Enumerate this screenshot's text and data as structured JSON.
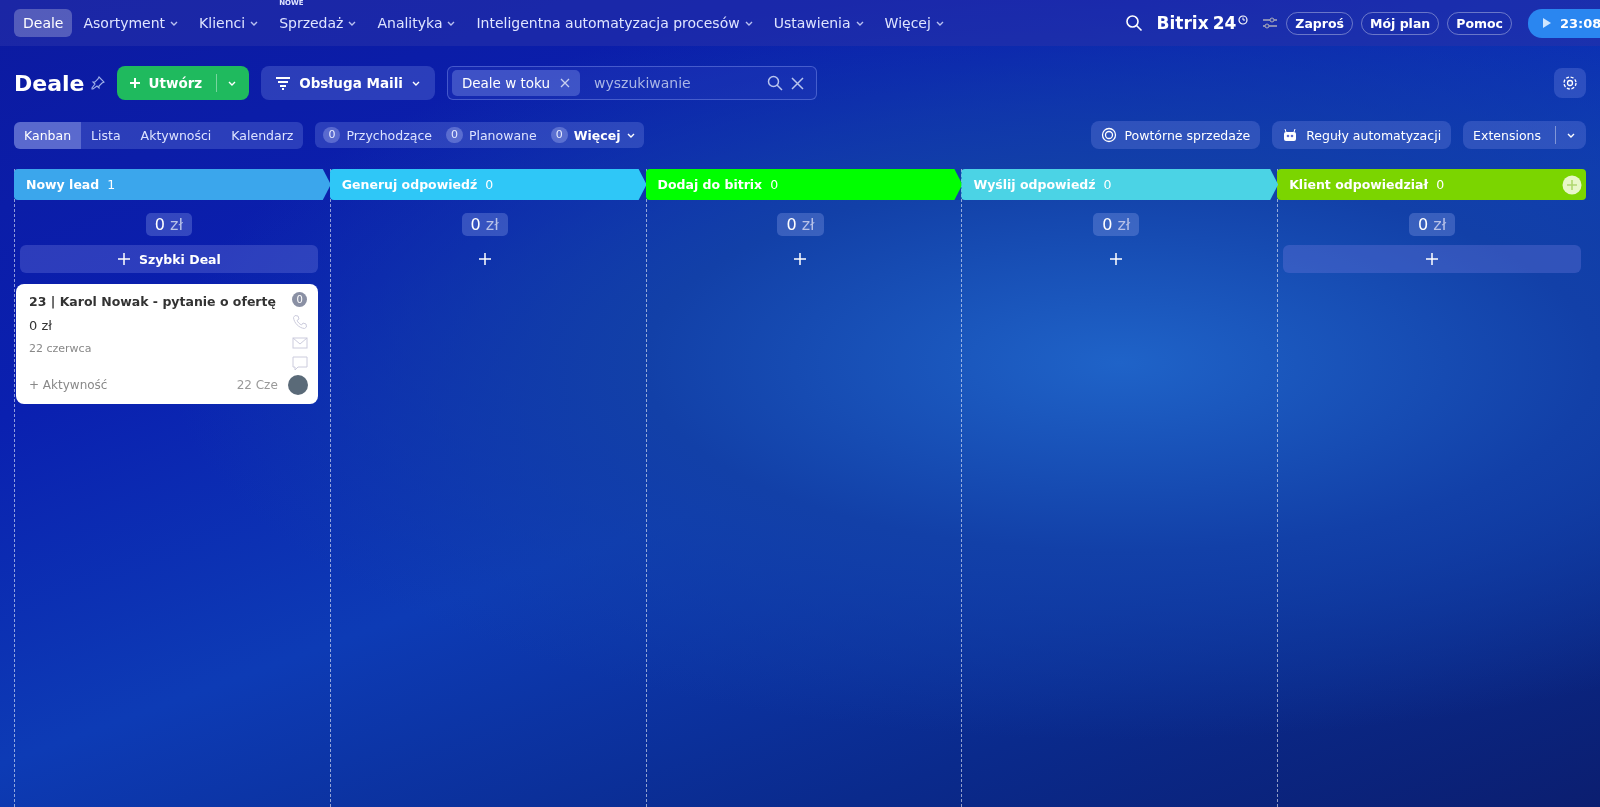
{
  "top_nav": {
    "items": [
      {
        "label": "Deale",
        "selected": true,
        "caret": false
      },
      {
        "label": "Asortyment",
        "selected": false,
        "caret": true
      },
      {
        "label": "Klienci",
        "selected": false,
        "caret": true
      },
      {
        "label": "Sprzedaż",
        "selected": false,
        "caret": true,
        "badge": "NOWE"
      },
      {
        "label": "Analityka",
        "selected": false,
        "caret": true
      },
      {
        "label": "Inteligentna automatyzacja procesów",
        "selected": false,
        "caret": true
      },
      {
        "label": "Ustawienia",
        "selected": false,
        "caret": true
      },
      {
        "label": "Więcej",
        "selected": false,
        "caret": true
      }
    ],
    "logo": {
      "name": "Bitrix",
      "number": "24"
    },
    "pills": [
      "Zaproś",
      "Mój plan",
      "Pomoc"
    ],
    "timer": "23:08"
  },
  "toolbar": {
    "title": "Deale",
    "create_button": "Utwórz",
    "mail_button": "Obsługa Maili",
    "filter_tag": "Deale w toku",
    "search": {
      "placeholder": "wyszukiwanie"
    }
  },
  "view_tabs": [
    {
      "label": "Kanban",
      "selected": true
    },
    {
      "label": "Lista",
      "selected": false
    },
    {
      "label": "Aktywności",
      "selected": false
    },
    {
      "label": "Kalendarz",
      "selected": false
    }
  ],
  "counters": [
    {
      "count": "0",
      "label": "Przychodzące",
      "kind": "counter"
    },
    {
      "count": "0",
      "label": "Planowane",
      "kind": "counter"
    },
    {
      "count": "0",
      "label": "Więcej",
      "kind": "menu"
    }
  ],
  "right_buttons": [
    {
      "label": "Powtórne sprzedaże",
      "kind": "repeat"
    },
    {
      "label": "Reguły automatyzacji",
      "kind": "robot"
    },
    {
      "label": "Extensions",
      "kind": "split"
    }
  ],
  "columns": [
    {
      "title": "Nowy lead",
      "count": "1",
      "color": "#3ba6ec",
      "kind": "stage",
      "sum": "0",
      "currency": "zł",
      "add_button": {
        "kind": "quick",
        "label": "Szybki Deal"
      },
      "cards": [
        {
          "title": "23 | Karol Nowak - pytanie o ofertę",
          "amount": "0 zł",
          "date": "22 czerwca",
          "counter": "0",
          "activity": "+ Aktywność",
          "short_date": "22 Cze"
        }
      ]
    },
    {
      "title": "Generuj odpowiedź",
      "count": "0",
      "color": "#2fc7f7",
      "kind": "stage",
      "sum": "0",
      "currency": "zł",
      "add_button": {
        "kind": "plain"
      }
    },
    {
      "title": "Dodaj do bitrix",
      "count": "0",
      "color": "#00ff00",
      "kind": "stage",
      "sum": "0",
      "currency": "zł",
      "add_button": {
        "kind": "plain"
      }
    },
    {
      "title": "Wyślij odpowiedź",
      "count": "0",
      "color": "#4bd3e5",
      "kind": "stage",
      "sum": "0",
      "currency": "zł",
      "add_button": {
        "kind": "plain"
      }
    },
    {
      "title": "Klient odpowiedział",
      "count": "0",
      "color": "#7bd500",
      "kind": "final",
      "sum": "0",
      "currency": "zł",
      "add_button": {
        "kind": "bar"
      }
    }
  ]
}
